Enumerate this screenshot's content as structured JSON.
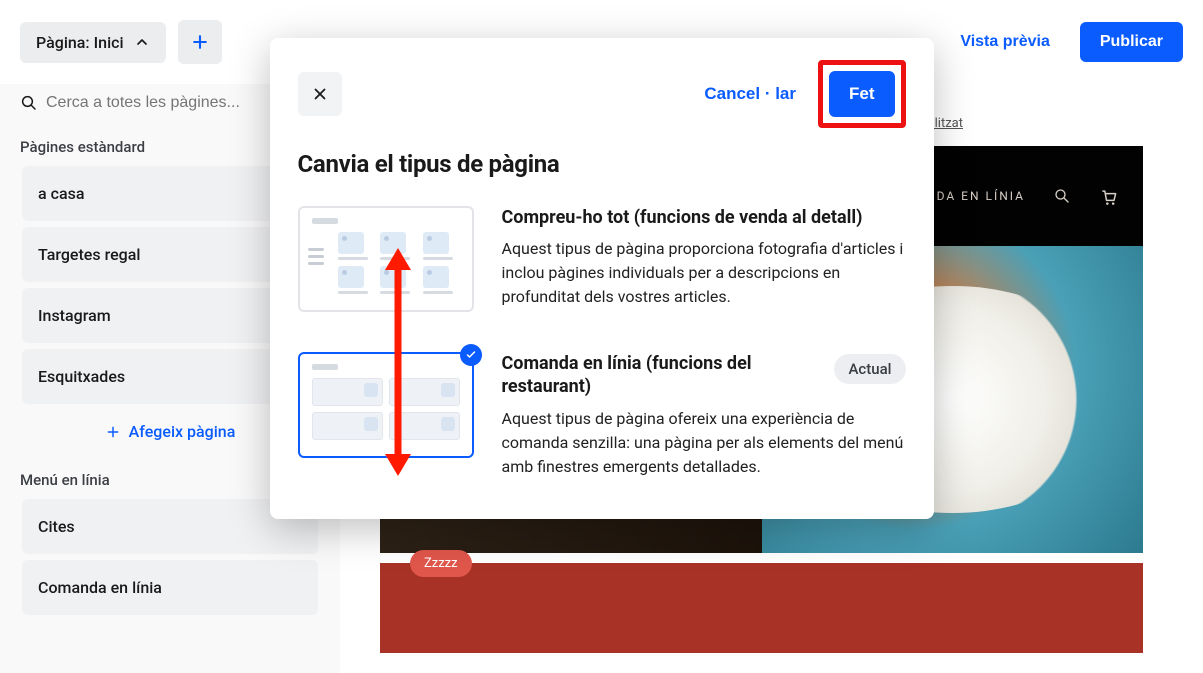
{
  "topbar": {
    "page_label": "Pàgina: Inici",
    "preview_label": "Vista prèvia",
    "publish_label": "Publicar"
  },
  "sidebar": {
    "search_placeholder": "Cerca a totes les pàgines...",
    "standard_section": "Pàgines estàndard",
    "standard_items": [
      "a casa",
      "Targetes regal",
      "Instagram",
      "Esquitxades"
    ],
    "add_page": "Afegeix pàgina",
    "online_menu_section": "Menú en línia",
    "online_menu_items": [
      "Cites",
      "Comanda en línia"
    ]
  },
  "canvas": {
    "nav_item": "DA EN LÍNIA",
    "personalize": "rsonalitzat",
    "badge": "Zzzzz"
  },
  "modal": {
    "cancel": "Cancel · lar",
    "done": "Fet",
    "title": "Canvia el tipus de pàgina",
    "opt1": {
      "title": "Compreu-ho tot (funcions de venda al detall)",
      "desc": "Aquest tipus de pàgina proporciona fotografia d'articles i inclou pàgines individuals per a descripcions en profunditat dels vostres articles."
    },
    "opt2": {
      "title": "Comanda en línia (funcions del restaurant)",
      "desc": "Aquest tipus de pàgina ofereix una experiència de comanda senzilla: una pàgina per als elements del menú amb finestres emergents detallades.",
      "current": "Actual"
    }
  }
}
